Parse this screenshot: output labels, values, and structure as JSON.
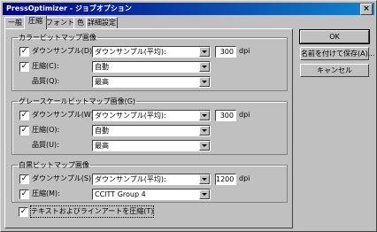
{
  "window": {
    "title": "PressOptimizer - ジョブオプション",
    "close_glyph": "×"
  },
  "tabs": [
    "一般",
    "圧縮",
    "フォント",
    "色",
    "詳細設定"
  ],
  "active_tab": "圧縮",
  "groups": [
    {
      "title": "カラービットマップ画像",
      "sampling": {
        "checked": true,
        "label": "ダウンサンプル(D):",
        "value": "ダウンサンプル(平均):",
        "resolution": "300",
        "unit": "dpi"
      },
      "compression": {
        "checked": true,
        "label": "圧縮(C):",
        "value": "自動"
      },
      "quality": {
        "label": "品質(Q):",
        "value": "最高"
      }
    },
    {
      "title": "グレースケールビットマップ画像(G)",
      "sampling": {
        "checked": true,
        "label": "ダウンサンプル(W):",
        "value": "ダウンサンプル(平均):",
        "resolution": "300",
        "unit": "dpi"
      },
      "compression": {
        "checked": true,
        "label": "圧縮(O):",
        "value": "自動"
      },
      "quality": {
        "label": "品質(U):",
        "value": "最高"
      }
    },
    {
      "title": "白黒ビットマップ画像",
      "sampling": {
        "checked": true,
        "label": "ダウンサンプル(S):",
        "value": "ダウンサンプル(平均):",
        "resolution": "1200",
        "unit": "dpi"
      },
      "compression": {
        "checked": true,
        "label": "圧縮(M):",
        "value": "CCITT Group 4"
      }
    }
  ],
  "bottom_checkbox": {
    "checked": true,
    "label": "テキストおよびラインアートを圧縮(T)"
  },
  "buttons": {
    "ok": "OK",
    "save_as": "名前を付けて保存(A)...",
    "cancel": "キャンセル"
  },
  "check_glyph": "✓"
}
